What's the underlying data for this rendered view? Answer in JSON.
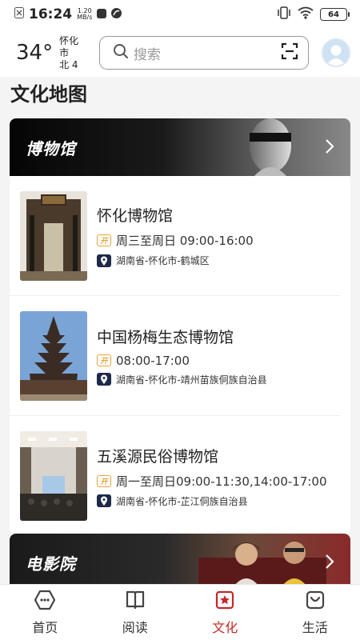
{
  "status_bar": {
    "time": "16:24",
    "speed_value": "1.20",
    "speed_unit": "MB/s",
    "battery": "64"
  },
  "header": {
    "temperature": "34°",
    "city": "怀化市",
    "wind": "北 4",
    "search_placeholder": "搜索"
  },
  "page_title": "文化地图",
  "museum_section": {
    "title": "博物馆",
    "items": [
      {
        "name": "怀化博物馆",
        "hours": "周三至周日 09:00-16:00",
        "address": "湖南省-怀化市-鹤城区"
      },
      {
        "name": "中国杨梅生态博物馆",
        "hours": "08:00-17:00",
        "address": "湖南省-怀化市-靖州苗族侗族自治县"
      },
      {
        "name": "五溪源民俗博物馆",
        "hours": "周一至周日09:00-11:30,14:00-17:00",
        "address": "湖南省-怀化市-芷江侗族自治县"
      }
    ]
  },
  "cinema_section": {
    "title": "电影院"
  },
  "bottom_nav": [
    {
      "label": "首页",
      "icon": "home-icon"
    },
    {
      "label": "阅读",
      "icon": "book-icon"
    },
    {
      "label": "文化",
      "icon": "culture-icon"
    },
    {
      "label": "生活",
      "icon": "life-icon"
    }
  ],
  "colors": {
    "accent": "#c62828",
    "open_badge": "#e8a33a",
    "pin_badge": "#1f2a4a"
  }
}
